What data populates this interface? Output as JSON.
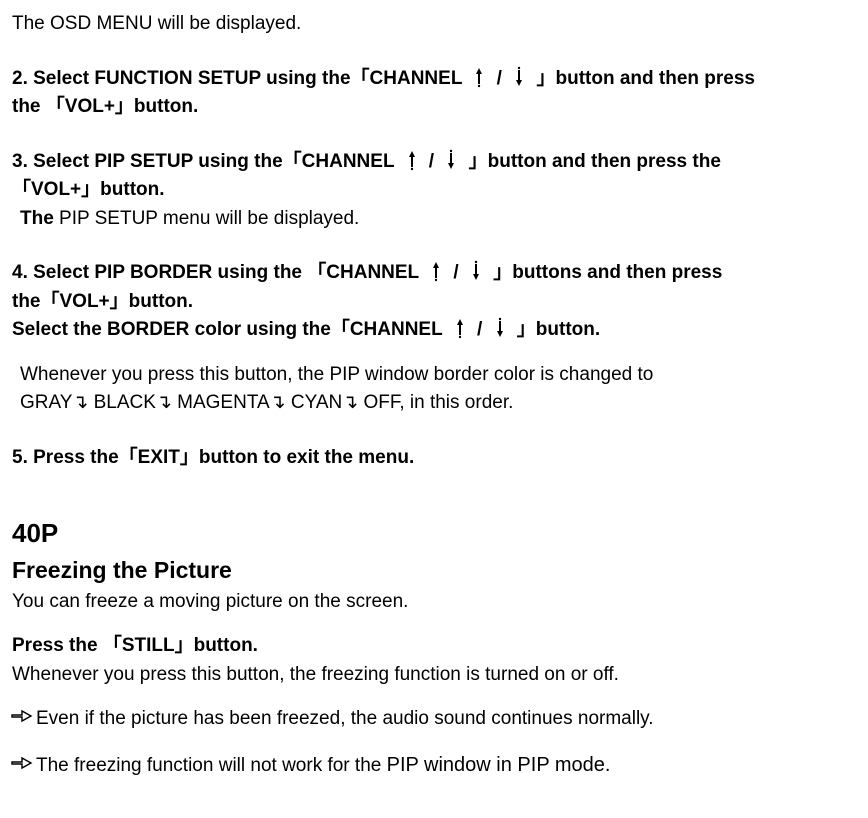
{
  "intro": "The OSD MENU will be displayed.",
  "step2": {
    "prefix": "2. Select FUNCTION SETUP using the「CHANNEL",
    "sep": "/",
    "mid": "」button and then press",
    "cont": "the 「VOL+」button."
  },
  "step3": {
    "prefix": "3. Select PIP SETUP using the「CHANNEL",
    "sep": "/",
    "mid": "」button and then press the",
    "cont": "「VOL+」button.",
    "the": "The",
    "msg": " PIP SETUP menu will be displayed."
  },
  "step4": {
    "prefix": "4. Select PIP BORDER using the 「CHANNEL",
    "sep": "/",
    "mid": "」buttons and then press",
    "cont": "the「VOL+」button.",
    "l2prefix": "Select the BORDER color using the「CHANNEL",
    "l2sep": "/",
    "l2mid": "」button.",
    "note1": "Whenever you press this button, the PIP window border color is changed to",
    "note2": "GRAY↴ BLACK↴ MAGENTA↴ CYAN↴ OFF, in this order."
  },
  "step5": "5. Press the「EXIT」button to exit the menu.",
  "pagenum": "40P",
  "freeze": {
    "title": "Freezing the Picture",
    "intro": "You can freeze a moving picture on the screen.",
    "press": "Press the 「STILL」button.",
    "desc": "Whenever you press this button, the freezing function is turned on or off.",
    "note1": "Even if the picture has been freezed, the audio sound continues normally.",
    "note2_a": "The freezing function will not work for the ",
    "note2_b": "PIP window in PIP mode."
  }
}
